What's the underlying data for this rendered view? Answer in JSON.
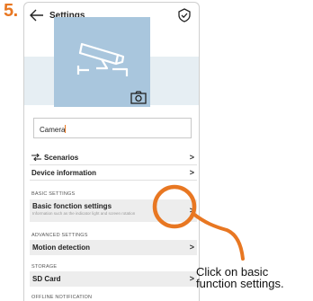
{
  "step": {
    "number": "5."
  },
  "header": {
    "title": "Settings",
    "back_icon": "arrow-left-icon",
    "corner_icon": "shield-check-icon"
  },
  "camera": {
    "name_value": "Camera",
    "hero_icon": "security-camera-icon",
    "photo_icon": "camera-icon"
  },
  "menu": {
    "scenarios_label": "Scenarios",
    "device_info_label": "Device information",
    "basic_section": "BASIC SETTINGS",
    "basic_label": "Basic fonction settings",
    "basic_desc": "Information such as the indicator light and screen rotation",
    "advanced_section": "ADVANCED SETTINGS",
    "motion_label": "Motion detection",
    "storage_section": "STORAGE",
    "sd_label": "SD Card",
    "offline_section": "OFFLINE NOTIFICATION",
    "chevron": ">"
  },
  "annotation": {
    "line1": "Click on basic",
    "line2": "function settings.",
    "accent_color": "#e87722"
  }
}
